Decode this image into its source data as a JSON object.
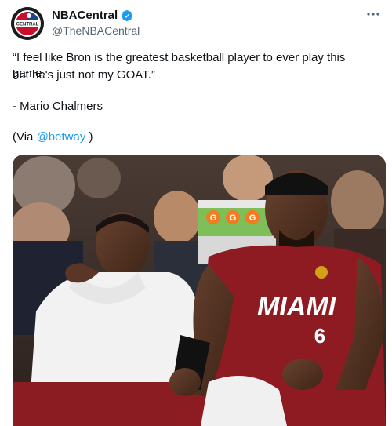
{
  "account": {
    "display_name": "NBACentral",
    "handle": "@TheNBACentral",
    "avatar_icon": "nba-central-logo-icon",
    "verified_icon": "verified-badge-icon",
    "verified_color": "#1d9bf0"
  },
  "menu": {
    "icon": "more-options-icon"
  },
  "tweet": {
    "quote_line1": "“I feel like Bron is the greatest basketball player to ever play this game,",
    "quote_line2": "but he's just not my GOAT.”",
    "attribution": "- Mario Chalmers",
    "via_prefix": "(Via ",
    "via_mention": "@betway",
    "via_suffix": " )"
  },
  "media": {
    "jersey_text": "MIAMI",
    "jersey_number": "6",
    "cup_letter": "G"
  },
  "colors": {
    "text_primary": "#0f1419",
    "text_secondary": "#536471",
    "link": "#1d9bf0"
  }
}
